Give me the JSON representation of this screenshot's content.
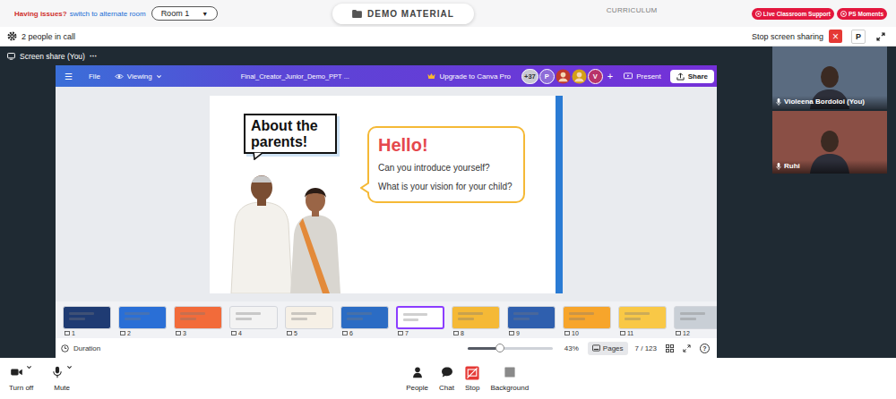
{
  "top_bar": {
    "issue_text": "Having issues?",
    "switch_link": "switch to alternate room",
    "room_select": {
      "label": "Room 1",
      "arrow": "▼"
    },
    "demo_button": "DEMO MATERIAL",
    "curriculum": "CURRICULUM",
    "actions": [
      {
        "label": "Live Classroom Support"
      },
      {
        "label": "PS Moments"
      }
    ]
  },
  "call_bar": {
    "people_count": "2 people in call",
    "stop_sharing": "Stop screen sharing",
    "close": "×",
    "user_initial": "P"
  },
  "share_tab": {
    "label": "Screen share (You)",
    "more": "···"
  },
  "canva": {
    "menu": "☰",
    "file": "File",
    "mode": "Viewing",
    "title": "Final_Creator_Junior_Demo_PPT ...",
    "upgrade": "Upgrade to Canva Pro",
    "collaborators": [
      {
        "kind": "count",
        "label": "+37",
        "color": "#c9c9d3"
      },
      {
        "kind": "initial",
        "label": "P",
        "color": "#8e6cd8"
      },
      {
        "kind": "photo",
        "label": "",
        "color": "#c0392b"
      },
      {
        "kind": "photo",
        "label": "",
        "color": "#d4a017"
      },
      {
        "kind": "initial",
        "label": "V",
        "color": "#b8336a"
      }
    ],
    "add_collaborator": "+",
    "present": "Present",
    "share": "Share"
  },
  "slide": {
    "badge": "About the parents!",
    "greeting": "Hello!",
    "questions": [
      "Can you introduce yourself?",
      "What is your vision for your child?"
    ]
  },
  "thumbnails": [
    {
      "page": "1",
      "selected": false,
      "color": "#1f3b73"
    },
    {
      "page": "2",
      "selected": false,
      "color": "#2a6fd6"
    },
    {
      "page": "3",
      "selected": false,
      "color": "#f26b3a"
    },
    {
      "page": "4",
      "selected": false,
      "color": "#f3f3f3"
    },
    {
      "page": "5",
      "selected": false,
      "color": "#f6f0e6"
    },
    {
      "page": "6",
      "selected": false,
      "color": "#2b6cc4"
    },
    {
      "page": "7",
      "selected": true,
      "color": "#ffffff"
    },
    {
      "page": "8",
      "selected": false,
      "color": "#f5b936"
    },
    {
      "page": "9",
      "selected": false,
      "color": "#2f5fae"
    },
    {
      "page": "10",
      "selected": false,
      "color": "#f7a52b"
    },
    {
      "page": "11",
      "selected": false,
      "color": "#f9c846"
    },
    {
      "page": "12",
      "selected": false,
      "color": "#c9cfd6"
    }
  ],
  "footer": {
    "duration": "Duration",
    "zoom": {
      "level": 0.38,
      "reading": "43%"
    },
    "pages_button": "Pages",
    "page_counter": "7 / 123",
    "help": "?"
  },
  "participants": [
    {
      "name": "Violeena Bordoloi (You)",
      "color": "#5a6b80"
    },
    {
      "name": "Ruhi",
      "color": "#8a4f45"
    }
  ],
  "controls": {
    "left": [
      {
        "label": "Turn off",
        "kind": "camera"
      },
      {
        "label": "Mute",
        "kind": "mic"
      }
    ],
    "center": [
      {
        "label": "People",
        "kind": "people"
      },
      {
        "label": "Chat",
        "kind": "chat"
      },
      {
        "label": "Stop",
        "kind": "stop"
      },
      {
        "label": "Background",
        "kind": "background"
      }
    ]
  }
}
